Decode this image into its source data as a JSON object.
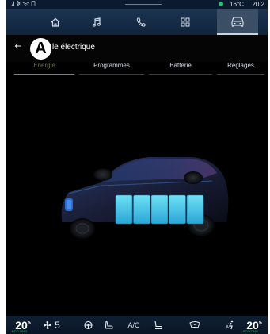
{
  "status_bar": {
    "left_icons": [
      "signal-icon",
      "bluetooth-icon",
      "wifi-icon",
      "phone-icon"
    ],
    "temperature": "16°C",
    "time": "20:2",
    "connection_color": "#27c07a"
  },
  "nav_bar": {
    "items": [
      {
        "name": "home",
        "icon": "home-icon",
        "active": false
      },
      {
        "name": "music",
        "icon": "music-note-icon",
        "active": false
      },
      {
        "name": "phone",
        "icon": "phone-icon",
        "active": false
      },
      {
        "name": "apps",
        "icon": "apps-grid-icon",
        "active": false
      },
      {
        "name": "vehicle",
        "icon": "car-icon",
        "active": true
      }
    ]
  },
  "header": {
    "marker": "A",
    "title": "le électrique"
  },
  "tabs": [
    {
      "label": "Énergie",
      "active": true
    },
    {
      "label": "Programmes",
      "active": false
    },
    {
      "label": "Batterie",
      "active": false
    },
    {
      "label": "Réglages",
      "active": false
    }
  ],
  "battery": {
    "cells": 5,
    "cell_color": "#3fc1e6"
  },
  "climate_bar": {
    "left_temp": "20",
    "left_temp_decimal": "5",
    "left_temp_sub": "ECO ONO",
    "fan_speed": "5",
    "ac_label": "A/C",
    "right_temp": "20",
    "right_temp_decimal": "5",
    "right_temp_sub": "ECO ONO"
  }
}
